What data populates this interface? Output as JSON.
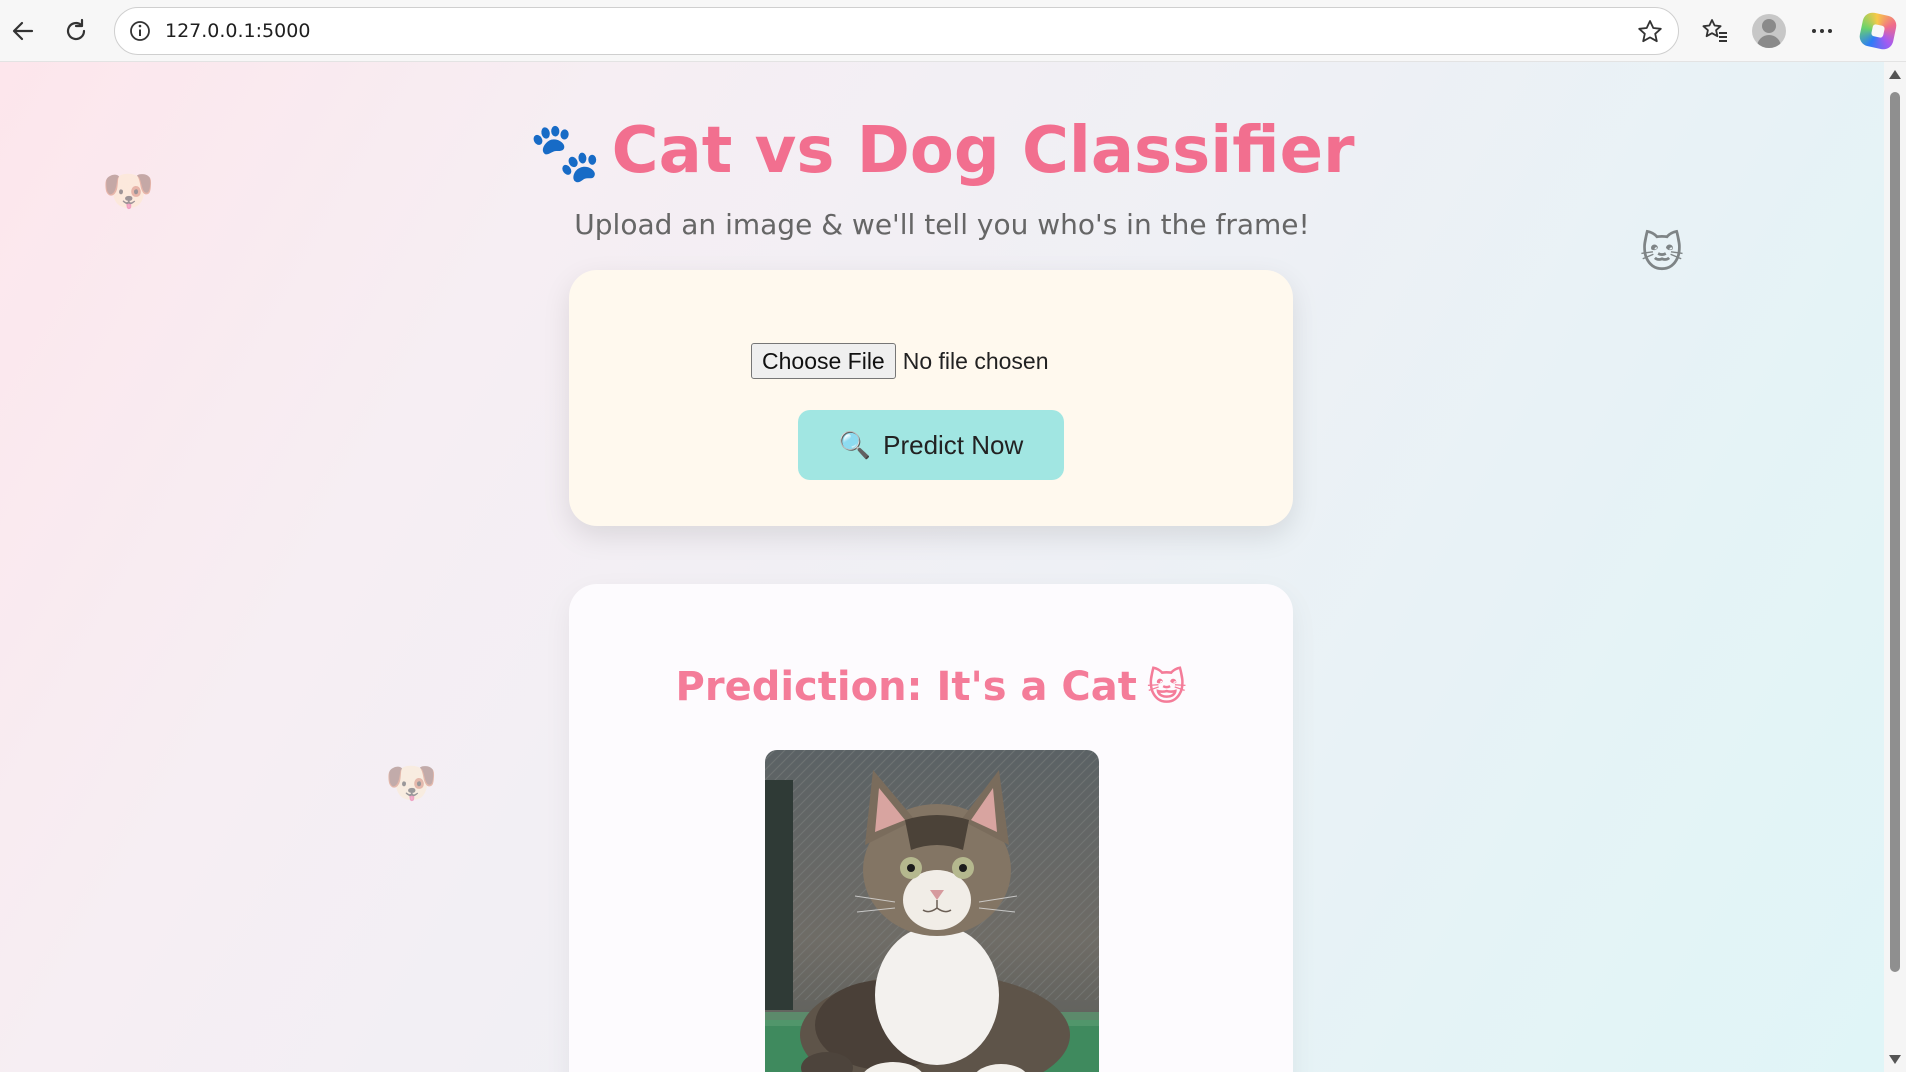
{
  "browser": {
    "url": "127.0.0.1:5000",
    "icons": [
      "back-arrow-icon",
      "refresh-icon",
      "info-icon",
      "star-icon",
      "favorites-icon",
      "profile-icon",
      "more-icon",
      "copilot-icon"
    ]
  },
  "page": {
    "title_emoji": "🐾",
    "title": "Cat vs Dog Classifier",
    "subtitle": "Upload an image & we'll tell you who's in the frame!",
    "decorations": [
      "🐶",
      "🐱",
      "🐶"
    ],
    "colors": {
      "title": "#f26f8f",
      "accent": "#a1e6e2",
      "card": "#fff9ee"
    }
  },
  "upload": {
    "choose_label": "Choose File",
    "file_status": "No file chosen",
    "predict_emoji": "🔍",
    "predict_label": "Predict Now"
  },
  "result": {
    "title": "Prediction: It's a Cat",
    "emoji": "😺",
    "image_subject": "tabby kitten on grass"
  }
}
